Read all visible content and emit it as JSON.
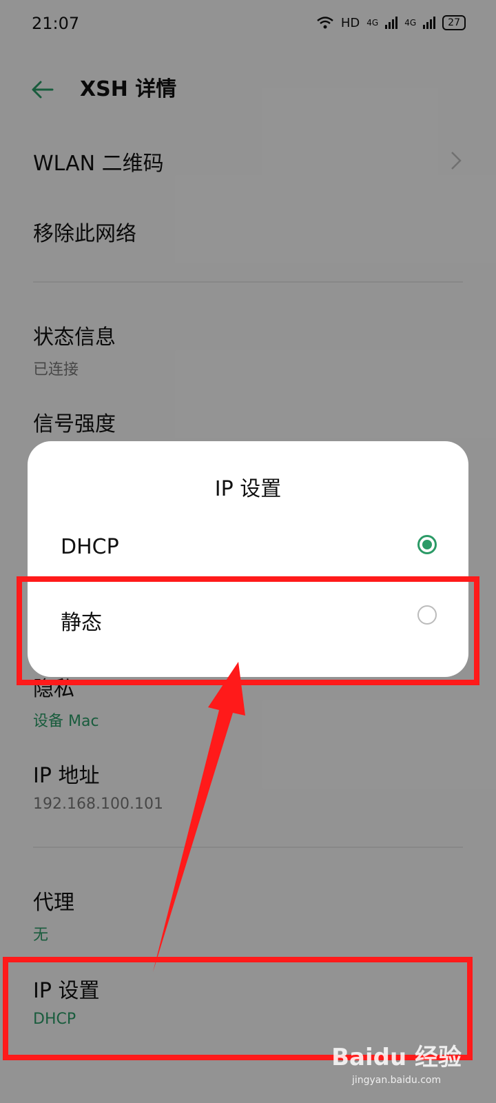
{
  "status": {
    "time": "21:07",
    "network": "HD",
    "sim1": "4G",
    "sim2": "4G",
    "battery": "27"
  },
  "topbar": {
    "title": "XSH 详情"
  },
  "rows": {
    "wlan_qr": "WLAN 二维码",
    "remove": "移除此网络",
    "status_title": "状态信息",
    "status_value": "已连接",
    "signal_title": "信号强度",
    "privacy_title": "隐私",
    "privacy_value": "设备 Mac",
    "ip_title": "IP 地址",
    "ip_value": "192.168.100.101",
    "proxy_title": "代理",
    "proxy_value": "无",
    "ipset_title": "IP 设置",
    "ipset_value": "DHCP"
  },
  "dialog": {
    "title": "IP 设置",
    "options": [
      {
        "label": "DHCP",
        "selected": true
      },
      {
        "label": "静态",
        "selected": false
      }
    ]
  },
  "watermark": {
    "brand": "Baidu 经验",
    "url": "jingyan.baidu.com"
  },
  "colors": {
    "accent": "#2b9a66",
    "annotation": "#ff1a1a"
  }
}
